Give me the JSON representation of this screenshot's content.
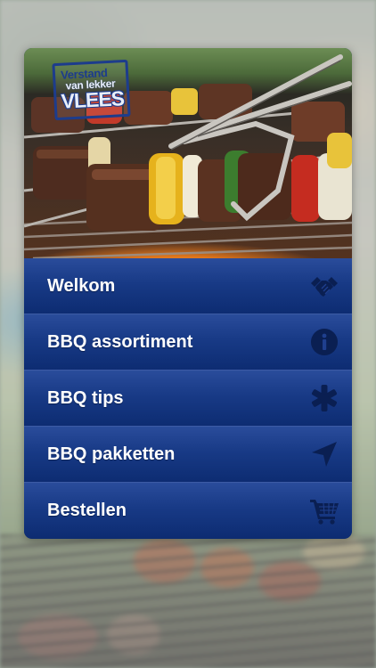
{
  "logo": {
    "line1": "Verstand",
    "line2": "van lekker",
    "line3": "VLEES"
  },
  "menu": [
    {
      "label": "Welkom",
      "icon": "handshake-icon"
    },
    {
      "label": "BBQ assortiment",
      "icon": "info-icon"
    },
    {
      "label": "BBQ tips",
      "icon": "asterisk-icon"
    },
    {
      "label": "BBQ pakketten",
      "icon": "navigation-arrow-icon"
    },
    {
      "label": "Bestellen",
      "icon": "shopping-cart-icon"
    }
  ],
  "colors": {
    "menu_top": "#2a4c9b",
    "menu_bottom": "#0d2c72",
    "icon": "#0a1f52",
    "logo_blue": "#1d3c8c"
  }
}
